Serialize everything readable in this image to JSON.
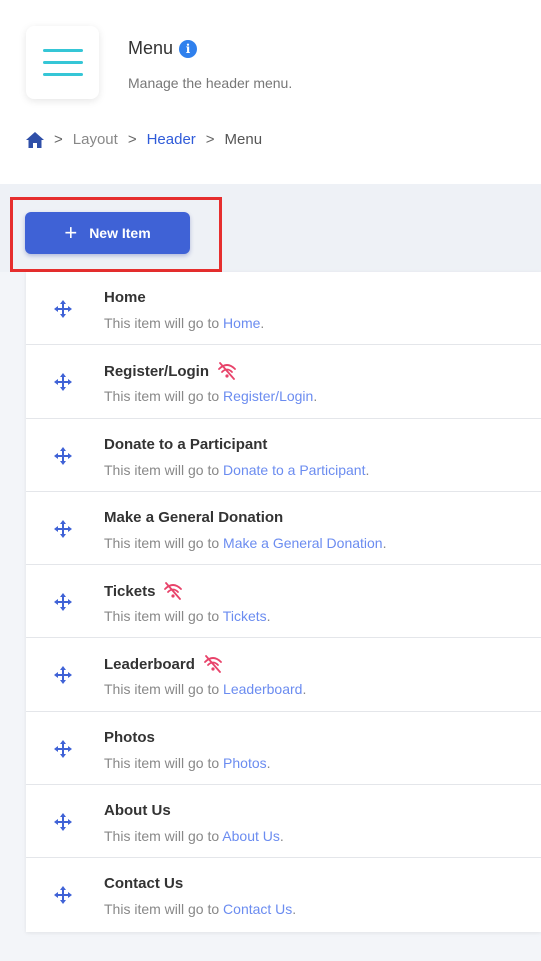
{
  "header": {
    "title": "Menu",
    "subtitle": "Manage the header menu.",
    "info_glyph": "i",
    "icon": "hamburger-menu-icon"
  },
  "breadcrumb": {
    "items": [
      "Layout",
      "Header",
      "Menu"
    ],
    "separator": ">"
  },
  "toolbar": {
    "new_item_label": "New Item",
    "plus_glyph": "+"
  },
  "menu_items": [
    {
      "title": "Home",
      "prefix": "This item will go to",
      "target": "Home",
      "suffix": ".",
      "hidden": false
    },
    {
      "title": "Register/Login",
      "prefix": "This item will go to",
      "target": "Register/Login",
      "suffix": ".",
      "hidden": true
    },
    {
      "title": "Donate to a Participant",
      "prefix": "This item will go to",
      "target": "Donate to a Participant",
      "suffix": ".",
      "hidden": false
    },
    {
      "title": "Make a General Donation",
      "prefix": "This item will go to",
      "target": "Make a General Donation",
      "suffix": ".",
      "hidden": false
    },
    {
      "title": "Tickets",
      "prefix": "This item will go to",
      "target": "Tickets",
      "suffix": ".",
      "hidden": true
    },
    {
      "title": "Leaderboard",
      "prefix": "This item will go to",
      "target": "Leaderboard",
      "suffix": ".",
      "hidden": true
    },
    {
      "title": "Photos",
      "prefix": "This item will go to",
      "target": "Photos",
      "suffix": ".",
      "hidden": false
    },
    {
      "title": "About Us",
      "prefix": "This item will go to",
      "target": "About Us",
      "suffix": ".",
      "hidden": false
    },
    {
      "title": "Contact Us",
      "prefix": "This item will go to",
      "target": "Contact Us",
      "suffix": ".",
      "hidden": false
    }
  ],
  "colors": {
    "accent": "#3f62d6",
    "link": "#6b8cf0",
    "hidden_icon": "#e8436a",
    "highlight": "#e62e2e",
    "menu_icon": "#35c6d6"
  }
}
